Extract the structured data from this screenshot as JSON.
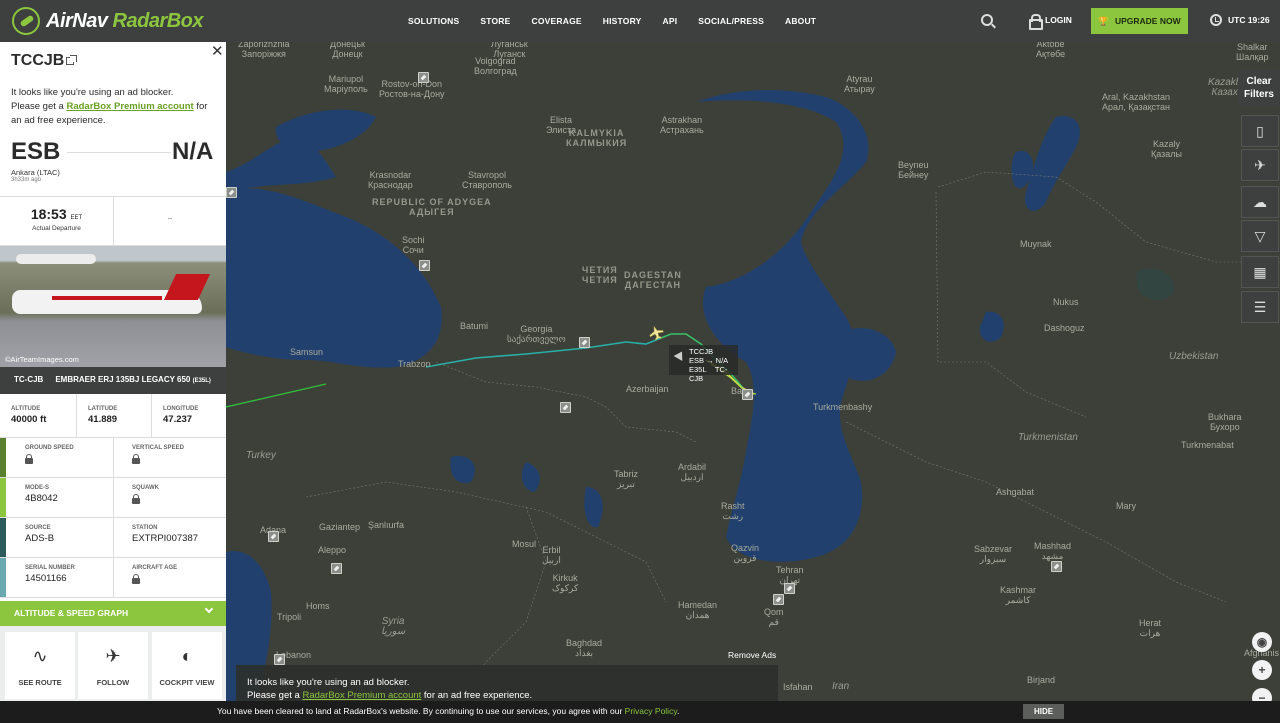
{
  "brand": {
    "name_main": "AirNav",
    "name_accent": "RadarBox"
  },
  "nav": [
    "SOLUTIONS",
    "STORE",
    "COVERAGE",
    "HISTORY",
    "API",
    "SOCIAL/PRESS",
    "ABOUT"
  ],
  "header": {
    "login": "LOGIN",
    "upgrade": "UPGRADE NOW",
    "utc": "UTC 19:26"
  },
  "flight": {
    "callsign": "TCCJB",
    "adblock": {
      "line1": "It looks like you're using an ad blocker.",
      "pre": "Please get a ",
      "link": "RadarBox Premium account",
      "post": " for an ad free experience."
    },
    "origin": {
      "iata": "ESB",
      "city": "Ankara (LTAC)",
      "ago": "3h33m ago"
    },
    "destination": {
      "iata": "N/A"
    },
    "departure": {
      "time": "18:53",
      "tz": "EET",
      "label": "Actual Departure"
    },
    "arrival": {
      "time": "--"
    },
    "photo_credit": "©AirTeamImages.com",
    "registration": "TC-CJB",
    "aircraft": "EMBRAER ERJ 135BJ LEGACY 650",
    "aircraft_code": "(E35L)",
    "altitude": {
      "label": "ALTITUDE",
      "value": "40000 ft"
    },
    "latitude": {
      "label": "LATITUDE",
      "value": "41.889"
    },
    "longitude": {
      "label": "LONGITUDE",
      "value": "47.237"
    },
    "ground_speed": {
      "label": "GROUND SPEED"
    },
    "vertical_speed": {
      "label": "VERTICAL SPEED"
    },
    "mode_s": {
      "label": "MODE-S",
      "value": "4B8042"
    },
    "squawk": {
      "label": "SQUAWK"
    },
    "source": {
      "label": "SOURCE",
      "value": "ADS-B"
    },
    "station": {
      "label": "STATION",
      "value": "EXTRPI007387"
    },
    "serial": {
      "label": "SERIAL NUMBER",
      "value": "14501166"
    },
    "aircraft_age": {
      "label": "AIRCRAFT AGE"
    },
    "graph_label": "ALTITUDE & SPEED GRAPH",
    "actions": [
      "SEE ROUTE",
      "FOLLOW",
      "COCKPIT VIEW"
    ],
    "row_colors": [
      "#5a7f2e",
      "#8cc63f",
      "#2d5a5a",
      "#6aa9b0"
    ]
  },
  "map": {
    "labels": [
      {
        "t": "Zaporizhzhia\nЗапоріжжя"
      },
      {
        "t": "Донецьк\nДонецк"
      },
      {
        "t": "Луганськ\nЛуганск"
      },
      {
        "t": "Mariupol\nМаріуполь"
      },
      {
        "t": "Rostov-on-Don\nРостов-на-Дону"
      },
      {
        "t": "Volgograd\nВолгоград"
      },
      {
        "t": "Atyrau\nАтырау"
      },
      {
        "t": "Aktobe\nАқтөбе"
      },
      {
        "t": "Shalkar\nШалқар"
      },
      {
        "t": "Elista\nЭлиста"
      },
      {
        "t": "Astrakhan\nАстрахань"
      },
      {
        "t": "KALMYKIA\nКАЛМЫКИЯ"
      },
      {
        "t": "Krasnodar\nКраснодар"
      },
      {
        "t": "Stavropol\nСтаврополь"
      },
      {
        "t": "REPUBLIC OF ADYGEA\nАДЫГЕЯ"
      },
      {
        "t": "Sochi\nСочи"
      },
      {
        "t": "ЧЕТИЯ\nЧЕТИЯ"
      },
      {
        "t": "DAGESTAN\nДАГЕСТАН"
      },
      {
        "t": "Beyneu\nБейнеу"
      },
      {
        "t": "Muynak"
      },
      {
        "t": "Nukus"
      },
      {
        "t": "Dashoguz"
      },
      {
        "t": "Uzbekistan"
      },
      {
        "t": "Batumi"
      },
      {
        "t": "Georgia\nსაქართველო"
      },
      {
        "t": "Trabzon"
      },
      {
        "t": "Samsun"
      },
      {
        "t": "Azerbaijan"
      },
      {
        "t": "Baku"
      },
      {
        "t": "Turkmenbashy"
      },
      {
        "t": "Turkmenistan"
      },
      {
        "t": "Bukhara\nБухоро"
      },
      {
        "t": "Turkmenabat"
      },
      {
        "t": "Turkey"
      },
      {
        "t": "Tabriz\nتبریز"
      },
      {
        "t": "Ardabil\nاردبیل"
      },
      {
        "t": "Rasht\nرشت"
      },
      {
        "t": "Ashgabat"
      },
      {
        "t": "Mary"
      },
      {
        "t": "Gaziantep"
      },
      {
        "t": "Şanlıurfa"
      },
      {
        "t": "Mosul"
      },
      {
        "t": "Erbil\nاربیل"
      },
      {
        "t": "Qazvin\nقزوین"
      },
      {
        "t": "Tehran\nتهران"
      },
      {
        "t": "Sabzevar\nسبزوار"
      },
      {
        "t": "Mashhad\nمشهد"
      },
      {
        "t": "Aleppo"
      },
      {
        "t": "Kirkuk\nکرکوک"
      },
      {
        "t": "Hamedan\nهمدان"
      },
      {
        "t": "Qom\nقم"
      },
      {
        "t": "Kashmar\nکاشمر"
      },
      {
        "t": "Homs"
      },
      {
        "t": "Syria\nسوريا"
      },
      {
        "t": "Baghdad\nبغداد"
      },
      {
        "t": "Tripoli"
      },
      {
        "t": "Herat\nهرات"
      },
      {
        "t": "Isfahan"
      },
      {
        "t": "Iran"
      },
      {
        "t": "Birjand"
      },
      {
        "t": "Kazakh\nКазах"
      },
      {
        "t": "Aral, Kazakhstan\nАрал, Қазақстан"
      },
      {
        "t": "Kazaly\nҚазалы"
      },
      {
        "t": "Adana"
      },
      {
        "t": "Lebanon"
      },
      {
        "t": "Afghanis"
      }
    ],
    "flight_tag": {
      "callsign": "TCCJB",
      "route": "ESB → N/A",
      "type": "E35L",
      "reg": "TC-CJB"
    },
    "clear_filters": "Clear\nFilters",
    "remove_ads": "Remove Ads",
    "adbar": {
      "line1": "It looks like you're using an ad blocker.",
      "pre": "Please get a ",
      "link": "RadarBox Premium account",
      "post": " for an ad free experience."
    }
  },
  "cookie": {
    "text": "You have been cleared to land at RadarBox's website. By continuing to use our services, you agree with our ",
    "link": "Privacy Policy",
    "end": ".",
    "hide": "HIDE"
  }
}
